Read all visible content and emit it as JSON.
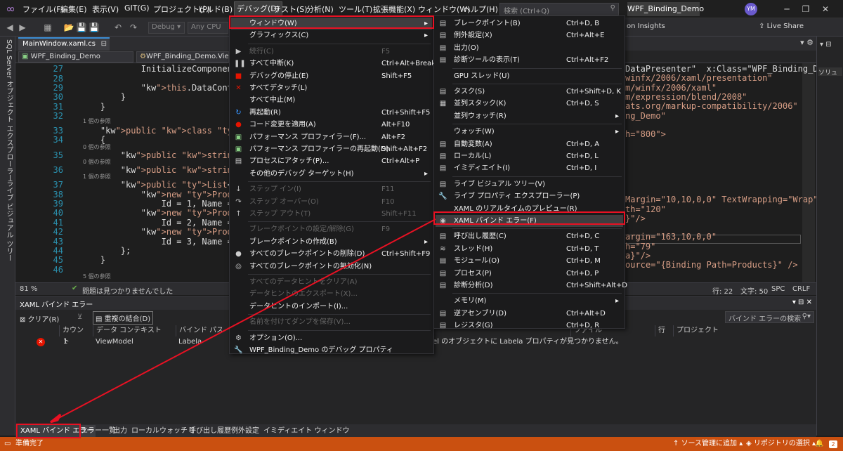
{
  "menubar": {
    "items": [
      "ファイル(F)",
      "編集(E)",
      "表示(V)",
      "GIT(G)",
      "プロジェクト(P)",
      "ビルド(B)",
      "デバッグ(D)",
      "テスト(S)",
      "分析(N)",
      "ツール(T)",
      "拡張機能(X)",
      "ウィンドウ(W)",
      "ヘルプ(H)"
    ],
    "search_placeholder": "検索 (Ctrl+Q)",
    "title": "WPF_Binding_Demo",
    "avatar": "YM"
  },
  "toolbar": {
    "config": "Debug",
    "platform": "Any CPU",
    "insights": "on Insights",
    "live_share": "Live Share"
  },
  "leftstrip": {
    "items": [
      "SQL Server オブジェクト エクスプローラー",
      "ライブ ビジュアル ツリー"
    ]
  },
  "doc": {
    "tab": "MainWindow.xaml.cs",
    "nav_project": "WPF_Binding_Demo",
    "nav_class": "WPF_Binding_Demo.ViewMod"
  },
  "editor": {
    "lines": [
      {
        "n": "27",
        "t": "            InitializeComponent();"
      },
      {
        "n": "28",
        "t": ""
      },
      {
        "n": "29",
        "t": "            this.DataContext = new Vi"
      },
      {
        "n": "30",
        "t": "        }"
      },
      {
        "n": "31",
        "t": "    }"
      },
      {
        "n": "32",
        "t": ""
      },
      {
        "n": "33",
        "t": "    public class ViewModel"
      },
      {
        "n": "34",
        "t": "    {"
      },
      {
        "n": "35",
        "t": "        public string Keyword { get;"
      },
      {
        "n": "36",
        "t": "        public string Label { get; se"
      },
      {
        "n": "37",
        "t": "        public List<Product> Products"
      },
      {
        "n": "38",
        "t": "            new Product{"
      },
      {
        "n": "39",
        "t": "                Id = 1, Name = \"オレン"
      },
      {
        "n": "40",
        "t": "            new Product{"
      },
      {
        "n": "41",
        "t": "                Id = 2, Name = \"アップ"
      },
      {
        "n": "42",
        "t": "            new Product{"
      },
      {
        "n": "43",
        "t": "                Id = 3, Name = \"ブレン"
      },
      {
        "n": "44",
        "t": "        };"
      },
      {
        "n": "45",
        "t": "    }"
      },
      {
        "n": "46",
        "t": ""
      }
    ],
    "refs1": "1 個の参照",
    "refs0": "0 個の参照",
    "refs5": "5 個の参照",
    "right_lines": [
      "DataPresenter\"  x:Class=\"WPF_Binding_Dem",
      "winfx/2006/xaml/presentation\"",
      "m/winfx/2006/xaml\"",
      "m/expression/blend/2008\"",
      "ats.org/markup-compatibility/2006\"",
      "ng_Demo\"",
      "",
      "h=\"800\">",
      "",
      "",
      "",
      "",
      "",
      "",
      "Margin=\"10,10,0,0\" TextWrapping=\"Wrap\"",
      "th=\"120\"",
      "}\"/>",
      "",
      "argin=\"163,10,0,0\"",
      "h=\"79\"",
      "a}\"/>",
      "ource=\"{Binding Path=Products}\" />"
    ]
  },
  "status_row": {
    "zoom": "81 %",
    "issues": "問題は見つかりませんでした",
    "line": "行: 22",
    "col": "文字: 50",
    "spc": "SPC",
    "crlf": "CRLF"
  },
  "panel": {
    "title": "XAML バインド エラー",
    "clear": "クリア(R)",
    "merge": "重複の結合(D)",
    "search": "バインド エラーの検索",
    "cols": [
      "カウント",
      "データ コンテキスト",
      "バインド パス",
      "ファイル",
      "行",
      "プロジェクト"
    ],
    "row": {
      "count": "1",
      "ctx": "ViewModel",
      "path": "Labela",
      "desc": "el のオブジェクトに Labela プロパティが見つかりません。"
    }
  },
  "bottom_tabs": [
    "XAML バインド エラー",
    "エラー一覧",
    "出力",
    "ローカル",
    "ウォッチ 1",
    "呼び出し履歴",
    "例外設定",
    "イミディエイト ウィンドウ"
  ],
  "statusbar": {
    "ready": "準備完了",
    "source": "ソース管理に追加",
    "repo": "リポジトリの選択",
    "count": "2"
  },
  "debug_menu": [
    {
      "icon": "",
      "label": "ウィンドウ(W)",
      "shortcut": "",
      "sub": true,
      "hl": true
    },
    {
      "icon": "",
      "label": "グラフィックス(C)",
      "shortcut": "",
      "sub": true
    },
    {
      "sep": true
    },
    {
      "icon": "▶",
      "label": "続行(C)",
      "shortcut": "F5",
      "dis": true
    },
    {
      "icon": "❚❚",
      "label": "すべて中断(K)",
      "shortcut": "Ctrl+Alt+Break"
    },
    {
      "icon": "■",
      "label": "デバッグの停止(E)",
      "shortcut": "Shift+F5",
      "color": "#e51400"
    },
    {
      "icon": "✕",
      "label": "すべてデタッチ(L)",
      "shortcut": "",
      "color": "#e51400"
    },
    {
      "icon": "",
      "label": "すべて中止(M)",
      "shortcut": ""
    },
    {
      "icon": "↻",
      "label": "再起動(R)",
      "shortcut": "Ctrl+Shift+F5",
      "color": "#3794ff"
    },
    {
      "icon": "●",
      "label": "コード変更を適用(A)",
      "shortcut": "Alt+F10",
      "color": "#e51400"
    },
    {
      "icon": "▣",
      "label": "パフォーマンス プロファイラー(F)...",
      "shortcut": "Alt+F2",
      "color": "#89d185"
    },
    {
      "icon": "▣",
      "label": "パフォーマンス プロファイラーの再起動(D)",
      "shortcut": "Shift+Alt+F2",
      "color": "#89d185"
    },
    {
      "icon": "▤",
      "label": "プロセスにアタッチ(P)...",
      "shortcut": "Ctrl+Alt+P",
      "color": "#cccccc"
    },
    {
      "icon": "",
      "label": "その他のデバッグ ターゲット(H)",
      "shortcut": "",
      "sub": true
    },
    {
      "sep": true
    },
    {
      "icon": "↓",
      "label": "ステップ イン(I)",
      "shortcut": "F11",
      "dis": true
    },
    {
      "icon": "↷",
      "label": "ステップ オーバー(O)",
      "shortcut": "F10",
      "dis": true
    },
    {
      "icon": "↑",
      "label": "ステップ アウト(T)",
      "shortcut": "Shift+F11",
      "dis": true
    },
    {
      "sep": true
    },
    {
      "icon": "",
      "label": "ブレークポイントの設定/解除(G)",
      "shortcut": "F9",
      "dis": true
    },
    {
      "icon": "",
      "label": "ブレークポイントの作成(B)",
      "shortcut": "",
      "sub": true
    },
    {
      "icon": "●",
      "label": "すべてのブレークポイントの削除(D)",
      "shortcut": "Ctrl+Shift+F9",
      "color": "#cccccc"
    },
    {
      "icon": "◎",
      "label": "すべてのブレークポイントの無効化(N)",
      "shortcut": "",
      "color": "#cccccc"
    },
    {
      "sep": true
    },
    {
      "icon": "",
      "label": "すべてのデータヒントをクリア(A)",
      "shortcut": "",
      "dis": true
    },
    {
      "icon": "",
      "label": "データヒントのエクスポート(X)...",
      "shortcut": "",
      "dis": true
    },
    {
      "icon": "",
      "label": "データヒントのインポート(I)...",
      "shortcut": ""
    },
    {
      "sep": true
    },
    {
      "icon": "",
      "label": "名前を付けてダンプを保存(V)...",
      "shortcut": "",
      "dis": true
    },
    {
      "sep": true
    },
    {
      "icon": "⚙",
      "label": "オプション(O)...",
      "shortcut": "",
      "color": "#cccccc"
    },
    {
      "icon": "🔧",
      "label": "WPF_Binding_Demo のデバッグ プロパティ",
      "shortcut": "",
      "color": "#cccccc"
    }
  ],
  "window_menu": [
    {
      "icon": "▤",
      "label": "ブレークポイント(B)",
      "shortcut": "Ctrl+D, B"
    },
    {
      "icon": "▤",
      "label": "例外設定(X)",
      "shortcut": "Ctrl+Alt+E"
    },
    {
      "icon": "▤",
      "label": "出力(O)",
      "shortcut": ""
    },
    {
      "icon": "▤",
      "label": "診断ツールの表示(T)",
      "shortcut": "Ctrl+Alt+F2"
    },
    {
      "sep": true
    },
    {
      "icon": "",
      "label": "GPU スレッド(U)",
      "shortcut": ""
    },
    {
      "sep": true
    },
    {
      "icon": "▤",
      "label": "タスク(S)",
      "shortcut": "Ctrl+Shift+D, K"
    },
    {
      "icon": "▦",
      "label": "並列スタック(K)",
      "shortcut": "Ctrl+D, S"
    },
    {
      "icon": "",
      "label": "並列ウォッチ(R)",
      "shortcut": "",
      "sub": true
    },
    {
      "sep": true
    },
    {
      "icon": "",
      "label": "ウォッチ(W)",
      "shortcut": "",
      "sub": true
    },
    {
      "icon": "▤",
      "label": "自動変数(A)",
      "shortcut": "Ctrl+D, A"
    },
    {
      "icon": "▤",
      "label": "ローカル(L)",
      "shortcut": "Ctrl+D, L"
    },
    {
      "icon": "▤",
      "label": "イミディエイト(I)",
      "shortcut": "Ctrl+D, I"
    },
    {
      "sep": true
    },
    {
      "icon": "▤",
      "label": "ライブ ビジュアル ツリー(V)",
      "shortcut": ""
    },
    {
      "icon": "🔧",
      "label": "ライブ プロパティ エクスプローラー(P)",
      "shortcut": ""
    },
    {
      "icon": "",
      "label": "XAML のリアルタイムのプレビュー(R)",
      "shortcut": ""
    },
    {
      "icon": "◉",
      "label": "XAML バインド エラー(F)",
      "shortcut": "",
      "hl": true
    },
    {
      "sep": true
    },
    {
      "icon": "▤",
      "label": "呼び出し履歴(C)",
      "shortcut": "Ctrl+D, C"
    },
    {
      "icon": "≋",
      "label": "スレッド(H)",
      "shortcut": "Ctrl+D, T"
    },
    {
      "icon": "▤",
      "label": "モジュール(O)",
      "shortcut": "Ctrl+D, M"
    },
    {
      "icon": "▤",
      "label": "プロセス(P)",
      "shortcut": "Ctrl+D, P"
    },
    {
      "icon": "▤",
      "label": "診断分析(D)",
      "shortcut": "Ctrl+Shift+Alt+D"
    },
    {
      "sep": true
    },
    {
      "icon": "",
      "label": "メモリ(M)",
      "shortcut": "",
      "sub": true
    },
    {
      "icon": "▤",
      "label": "逆アセンブリ(D)",
      "shortcut": "Ctrl+Alt+D"
    },
    {
      "icon": "▤",
      "label": "レジスタ(G)",
      "shortcut": "Ctrl+D, R"
    }
  ]
}
